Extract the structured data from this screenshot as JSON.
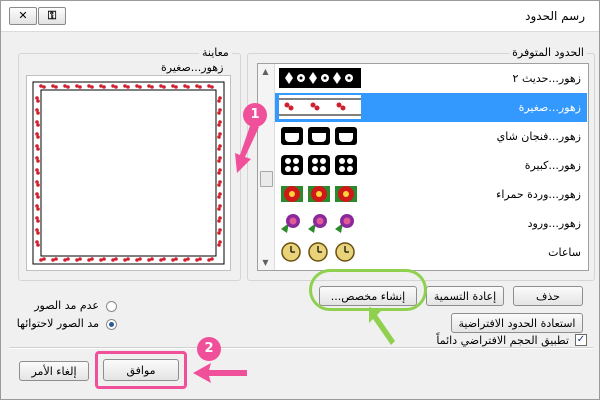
{
  "dialog": {
    "title": "رسم الحدود",
    "close_glyph": "✕",
    "help_glyph": "⚿"
  },
  "available": {
    "group_label": "الحدود المتوفرة",
    "items": [
      {
        "label": "زهور...حديث ٢",
        "pattern": "flowers-modern"
      },
      {
        "label": "زهور...صغيرة",
        "pattern": "flowers-small",
        "selected": true
      },
      {
        "label": "زهور...فنجان شاي",
        "pattern": "teacups"
      },
      {
        "label": "زهور...كبيرة",
        "pattern": "flowers-large"
      },
      {
        "label": "زهور...وردة حمراء",
        "pattern": "red-rose"
      },
      {
        "label": "زهور...ورود",
        "pattern": "roses"
      },
      {
        "label": "ساعات",
        "pattern": "clocks"
      }
    ]
  },
  "preview": {
    "group_label": "معاينة",
    "selected_name": "زهور...صغيرة"
  },
  "buttons": {
    "delete": "حذف",
    "rename": "إعادة التسمية",
    "create_custom": "إنشاء مخصص...",
    "restore_defaults": "استعادة الحدود الافتراضية",
    "ok": "موافق",
    "cancel": "إلغاء الأمر"
  },
  "options": {
    "no_picture_size": "عدم مد الصور",
    "stretch_to_fit": "مد الصور لاحتوائها",
    "stretch_selected": true,
    "apply_default_size": "تطبيق الحجم الافتراضي دائماً",
    "apply_default_checked": true
  },
  "callouts": [
    "1",
    "2"
  ],
  "colors": {
    "accent_pink": "#f0509a",
    "highlight_green": "#8fd14f",
    "selection_blue": "#3399ff"
  }
}
